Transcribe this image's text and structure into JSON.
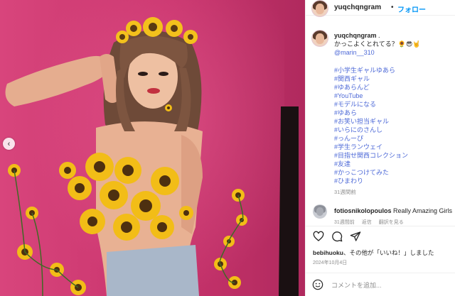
{
  "post": {
    "username": "yuqchqngram",
    "dot": "•",
    "follow_label": "フォロー",
    "caption_username": "yuqchqngram",
    "caption_dot": ".",
    "caption_text": "かっこよくとれてる？🌻😎🤘",
    "mention": "@marin__310",
    "hashtags": [
      "#小学生ギャルゆあら",
      "#関西ギャル",
      "#ゆあらんど",
      "#YouTube",
      "#モデルになる",
      "#ゆあら",
      "#お笑い担当ギャル",
      "#いらにのさんし",
      "#っんーぴ",
      "#学生ランウェイ",
      "#目指せ関西コレクション",
      "#友達",
      "#かっこつけてみた",
      "#ひまわり"
    ],
    "caption_time": "31週間前"
  },
  "comment": {
    "username": "fotiosnikolopoulos",
    "text": "Really Amazing Girls",
    "time": "31週間前",
    "reply": "返信",
    "translate": "翻訳を見る"
  },
  "likes": {
    "user": "bebihuoku",
    "rest": "、その他が「いいね！」しました"
  },
  "post_date": "2024年10月4日",
  "add_comment_placeholder": "コメントを追加...",
  "icons": {
    "prev": "chevron-left-icon",
    "like": "heart-icon",
    "comment": "comment-bubble-icon",
    "share": "paper-plane-icon",
    "emoji": "smiley-icon"
  },
  "colors": {
    "accent": "#0095f6",
    "link": "#4c68d7",
    "muted": "#8e8e8e",
    "backdrop": "#c8336c"
  }
}
